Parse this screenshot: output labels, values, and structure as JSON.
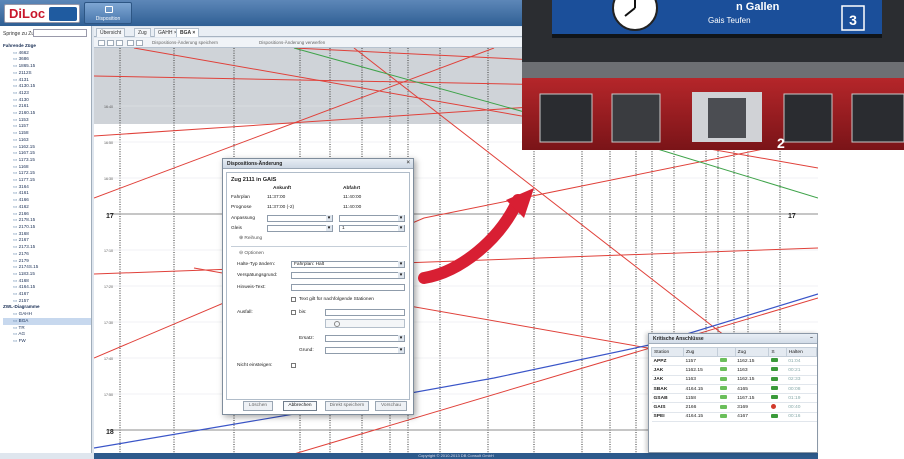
{
  "app": {
    "logo_text": "DiLoc",
    "dispo_button": "Disposition"
  },
  "sidebar": {
    "jump_label": "Springe zu Zug:",
    "tree": [
      {
        "label": "Fahrende Züge",
        "level": 0
      },
      {
        "label": "4662",
        "level": 1
      },
      {
        "label": "3686",
        "level": 1
      },
      {
        "label": "1865.15",
        "level": 1
      },
      {
        "label": "2112S",
        "level": 1
      },
      {
        "label": "4131",
        "level": 1
      },
      {
        "label": "4130.15",
        "level": 1
      },
      {
        "label": "4123",
        "level": 1
      },
      {
        "label": "4130",
        "level": 1
      },
      {
        "label": "2161",
        "level": 1
      },
      {
        "label": "2160.15",
        "level": 1
      },
      {
        "label": "1153",
        "level": 1
      },
      {
        "label": "1157",
        "level": 1
      },
      {
        "label": "1158",
        "level": 1
      },
      {
        "label": "1163",
        "level": 1
      },
      {
        "label": "1162.15",
        "level": 1
      },
      {
        "label": "1167.15",
        "level": 1
      },
      {
        "label": "1173.15",
        "level": 1
      },
      {
        "label": "1168",
        "level": 1
      },
      {
        "label": "1172.15",
        "level": 1
      },
      {
        "label": "1177.15",
        "level": 1
      },
      {
        "label": "3164",
        "level": 1
      },
      {
        "label": "4161",
        "level": 1
      },
      {
        "label": "4166",
        "level": 1
      },
      {
        "label": "4162",
        "level": 1
      },
      {
        "label": "2166",
        "level": 1
      },
      {
        "label": "2178.15",
        "level": 1
      },
      {
        "label": "2170.15",
        "level": 1
      },
      {
        "label": "3168",
        "level": 1
      },
      {
        "label": "2167",
        "level": 1
      },
      {
        "label": "2173.15",
        "level": 1
      },
      {
        "label": "2176",
        "level": 1
      },
      {
        "label": "2179",
        "level": 1
      },
      {
        "label": "2174S.15",
        "level": 1
      },
      {
        "label": "1183.15",
        "level": 1
      },
      {
        "label": "4168",
        "level": 1
      },
      {
        "label": "4164.15",
        "level": 1
      },
      {
        "label": "4167",
        "level": 1
      },
      {
        "label": "2157",
        "level": 1
      },
      {
        "label": "ZWL-Diagramme",
        "level": 0
      },
      {
        "label": "GAHH",
        "level": 1
      },
      {
        "label": "BGA",
        "level": 1,
        "selected": true
      },
      {
        "label": "TR",
        "level": 1
      },
      {
        "label": "AG",
        "level": 1
      },
      {
        "label": "FW",
        "level": 1
      }
    ]
  },
  "tabs": [
    "Übersicht",
    "Zug",
    "GAHH ×",
    "BGA ×"
  ],
  "toolbar": {
    "save_text": "Dispositions-Änderung speichern",
    "discard_text": "Dispositions-Änderung verwerfen"
  },
  "graph": {
    "hours_major": [
      "17",
      "18"
    ],
    "hours_minor": [
      "16:50",
      "16:40",
      "16:30",
      "17:10",
      "17:20",
      "17:30",
      "17:40",
      "17:50"
    ]
  },
  "dialog": {
    "title": "Dispositions-Änderung",
    "heading": "Zug 2111 in GAIS",
    "col_arrival": "Ankunft",
    "col_departure": "Abfahrt",
    "row_plan": "Fahrplan",
    "plan_arrival": "11:37:00",
    "plan_departure": "11:40:00",
    "row_forecast": "Prognose",
    "forecast_arrival": "11:37:00 (-2)",
    "forecast_departure": "11:40:00",
    "row_adjust": "Anpassung",
    "row_track": "Gleis",
    "track_value": "1",
    "section_order": "Reihung",
    "section_options": "Optionen",
    "stop_type_label": "Halte-Typ ändern:",
    "stop_type_value": "Fahrplan: Halt",
    "delay_label": "Verspätungsgrund:",
    "hint_label": "Hinweis-Text:",
    "hint_check": "Text gilt für nachfolgende Stationen",
    "cancel_label": "Ausfall:",
    "until_label": "bis:",
    "replace_label": "Ersatz:",
    "reason_label": "Grund:",
    "no_board_label": "Nicht einsteigen:",
    "btn_delete": "Löschen",
    "btn_cancel": "Abbrechen",
    "btn_save_direct": "Direkt speichern",
    "btn_preview": "Vorschau"
  },
  "photo": {
    "sign_text": "Gais Teufen",
    "sign_text2": "n Gallen",
    "platform_number": "3",
    "car_number": "2"
  },
  "critical": {
    "title": "Kritische Anschlüsse",
    "headers": [
      "Station",
      "Zug",
      "",
      "Zug",
      "S",
      "Halten"
    ],
    "rows": [
      {
        "station": "APPZ",
        "zug1": "1157",
        "zug2": "1162.15",
        "halten": "01:04",
        "status": "ok"
      },
      {
        "station": "JAK",
        "zug1": "1162.15",
        "zug2": "1163",
        "halten": "00:21",
        "status": "ok"
      },
      {
        "station": "JAK",
        "zug1": "1163",
        "zug2": "1162.15",
        "halten": "02:33",
        "status": "ok"
      },
      {
        "station": "SBAK",
        "zug1": "4164.15",
        "zug2": "4165",
        "halten": "00:08",
        "status": "ok"
      },
      {
        "station": "GSAB",
        "zug1": "1158",
        "zug2": "1167.15",
        "halten": "01:19",
        "status": "ok"
      },
      {
        "station": "GAIS",
        "zug1": "2166",
        "zug2": "3169",
        "halten": "00:40",
        "status": "bad"
      },
      {
        "station": "SPEI",
        "zug1": "4164.15",
        "zug2": "4167",
        "halten": "00:16",
        "status": "ok"
      }
    ]
  },
  "footer": "Copyright © 2010-2013 DB Consult GmbH",
  "colors": {
    "brand_red": "#c8162b",
    "header_blue": "#2f5f94",
    "train_red": "#e0413a",
    "train_blue": "#3a55c8",
    "train_green": "#3fa34a"
  }
}
